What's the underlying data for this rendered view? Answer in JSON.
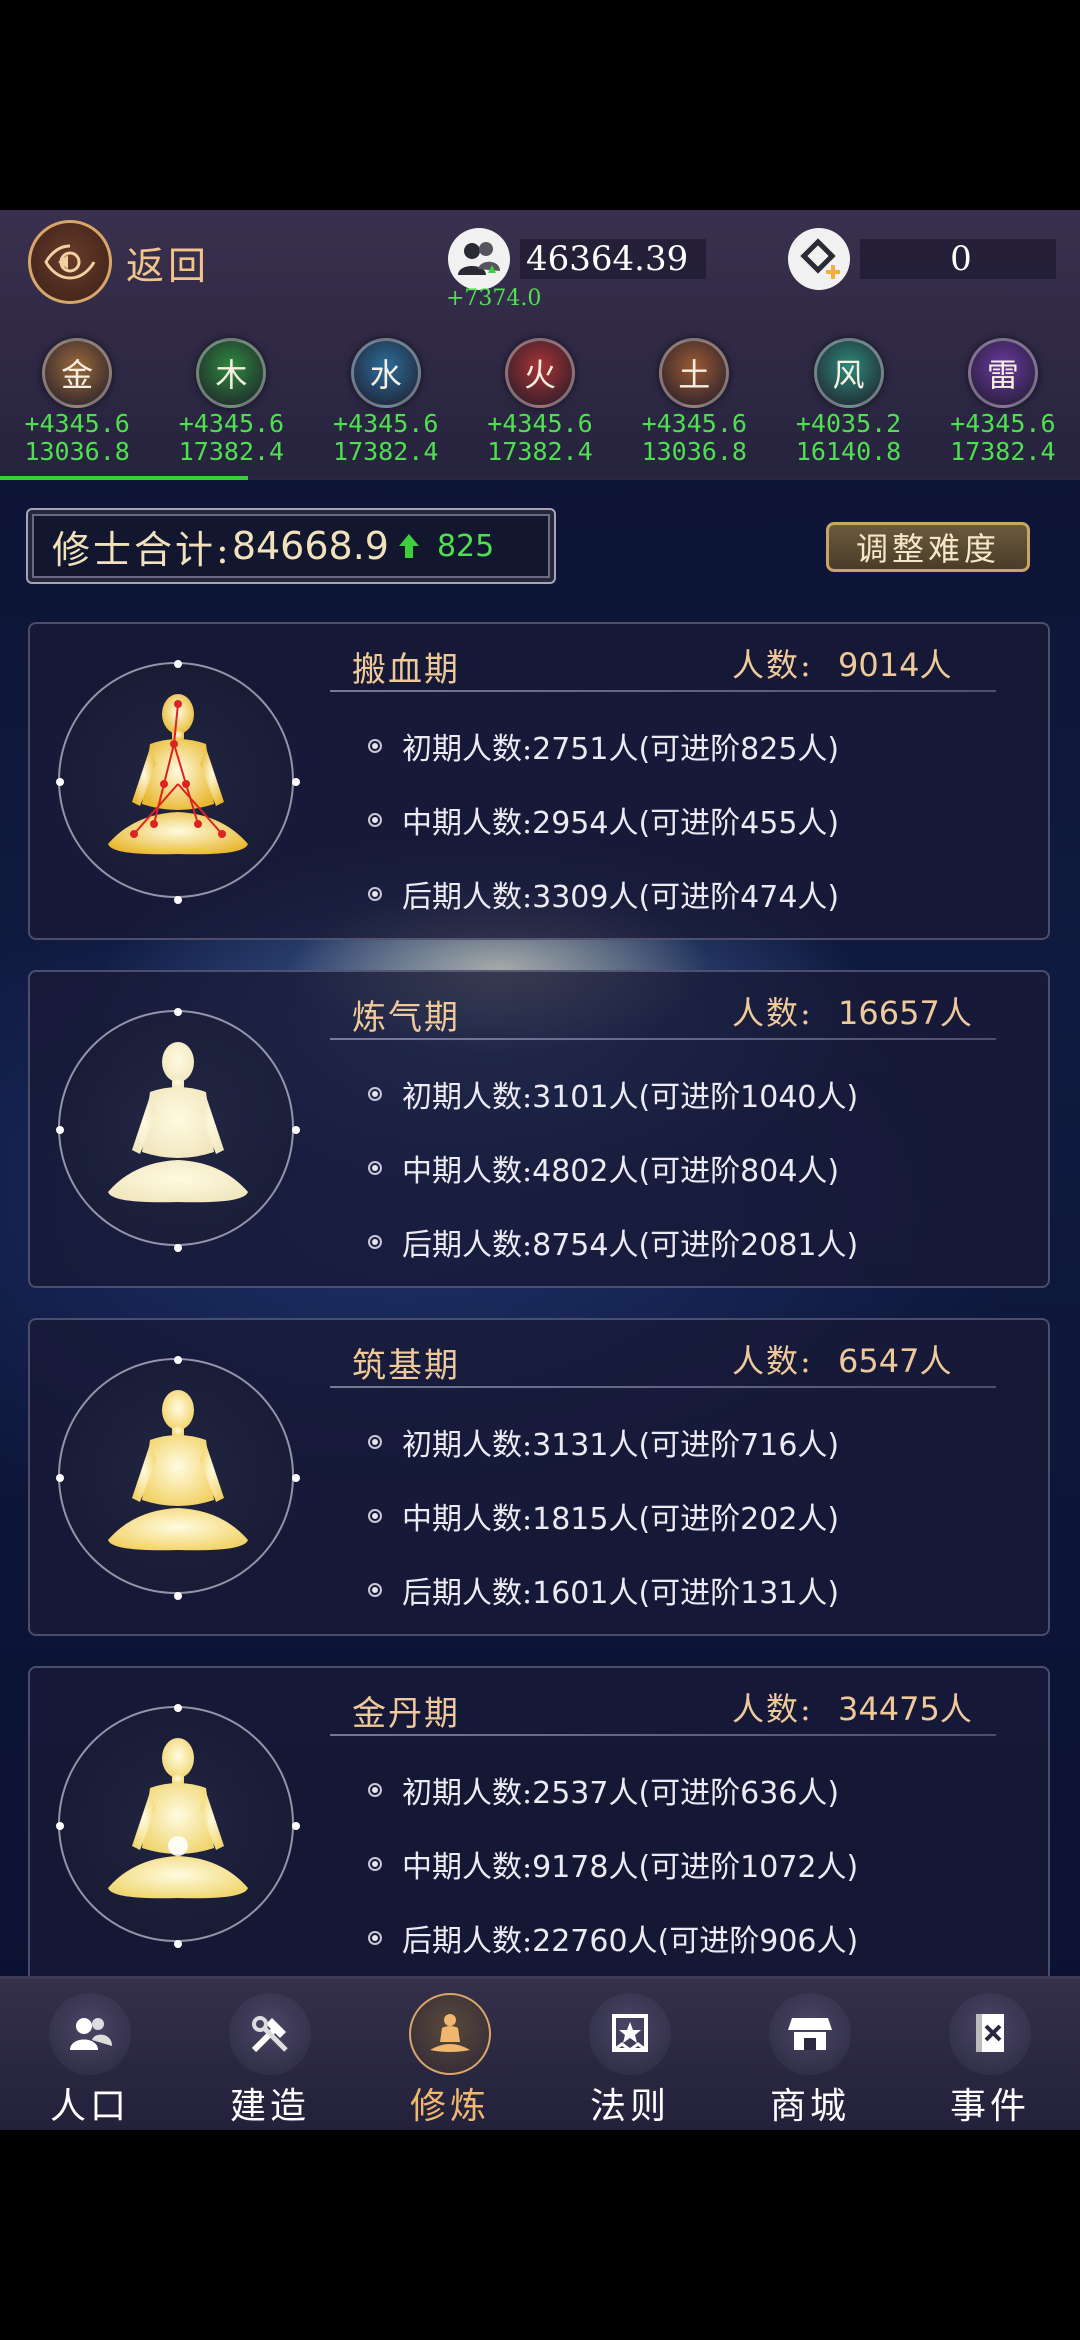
{
  "header": {
    "back_label": "返回",
    "population_value": "46364.39",
    "population_delta": "+7374.0",
    "currency_value": "0"
  },
  "elements": [
    {
      "name": "金",
      "rate": "+4345.6",
      "total": "13036.8",
      "color": "#9a6a3a"
    },
    {
      "name": "木",
      "rate": "+4345.6",
      "total": "17382.4",
      "color": "#2e8a3e"
    },
    {
      "name": "水",
      "rate": "+4345.6",
      "total": "17382.4",
      "color": "#2c6e9a"
    },
    {
      "name": "火",
      "rate": "+4345.6",
      "total": "17382.4",
      "color": "#a83434"
    },
    {
      "name": "土",
      "rate": "+4345.6",
      "total": "13036.8",
      "color": "#9a5a34"
    },
    {
      "name": "风",
      "rate": "+4035.2",
      "total": "16140.8",
      "color": "#2e8a7a"
    },
    {
      "name": "雷",
      "rate": "+4345.6",
      "total": "17382.4",
      "color": "#6a3aa0"
    }
  ],
  "progress": 0.23,
  "totals": {
    "label": "修士合计:",
    "value": "84668.9",
    "gain": "825",
    "difficulty_button": "调整难度"
  },
  "count_label": "人数:",
  "realms": [
    {
      "name": "搬血期",
      "count": "9014人",
      "figure": "meditation-figure-meridians",
      "rows": [
        {
          "label": "初期人数:",
          "value": "2751人(可进阶825人)"
        },
        {
          "label": "中期人数:",
          "value": "2954人(可进阶455人)"
        },
        {
          "label": "后期人数:",
          "value": "3309人(可进阶474人)"
        }
      ]
    },
    {
      "name": "炼气期",
      "count": "16657人",
      "figure": "meditation-figure-qi",
      "rows": [
        {
          "label": "初期人数:",
          "value": "3101人(可进阶1040人)"
        },
        {
          "label": "中期人数:",
          "value": "4802人(可进阶804人)"
        },
        {
          "label": "后期人数:",
          "value": "8754人(可进阶2081人)"
        }
      ]
    },
    {
      "name": "筑基期",
      "count": "6547人",
      "figure": "meditation-figure-foundation",
      "rows": [
        {
          "label": "初期人数:",
          "value": "3131人(可进阶716人)"
        },
        {
          "label": "中期人数:",
          "value": "1815人(可进阶202人)"
        },
        {
          "label": "后期人数:",
          "value": "1601人(可进阶131人)"
        }
      ]
    },
    {
      "name": "金丹期",
      "count": "34475人",
      "figure": "meditation-figure-golden-core",
      "rows": [
        {
          "label": "初期人数:",
          "value": "2537人(可进阶636人)"
        },
        {
          "label": "中期人数:",
          "value": "9178人(可进阶1072人)"
        },
        {
          "label": "后期人数:",
          "value": "22760人(可进阶906人)"
        }
      ]
    }
  ],
  "nav": [
    {
      "label": "人口",
      "icon": "people-icon"
    },
    {
      "label": "建造",
      "icon": "build-tools-icon"
    },
    {
      "label": "修炼",
      "icon": "meditation-icon",
      "active": true
    },
    {
      "label": "法则",
      "icon": "law-banner-icon"
    },
    {
      "label": "商城",
      "icon": "shop-icon"
    },
    {
      "label": "事件",
      "icon": "event-book-icon"
    }
  ]
}
